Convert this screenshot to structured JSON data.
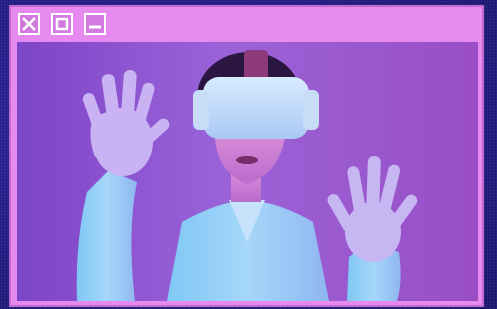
{
  "window": {
    "controls": [
      {
        "icon": "close-icon"
      },
      {
        "icon": "maximize-icon"
      },
      {
        "icon": "minimize-icon"
      }
    ],
    "image": {
      "subject": "person-wearing-vr-headset"
    }
  },
  "colors": {
    "frame": "#e68af0",
    "frame_border": "#c26ad0",
    "desktop": "#241e8a",
    "control_border": "#ffffff"
  }
}
